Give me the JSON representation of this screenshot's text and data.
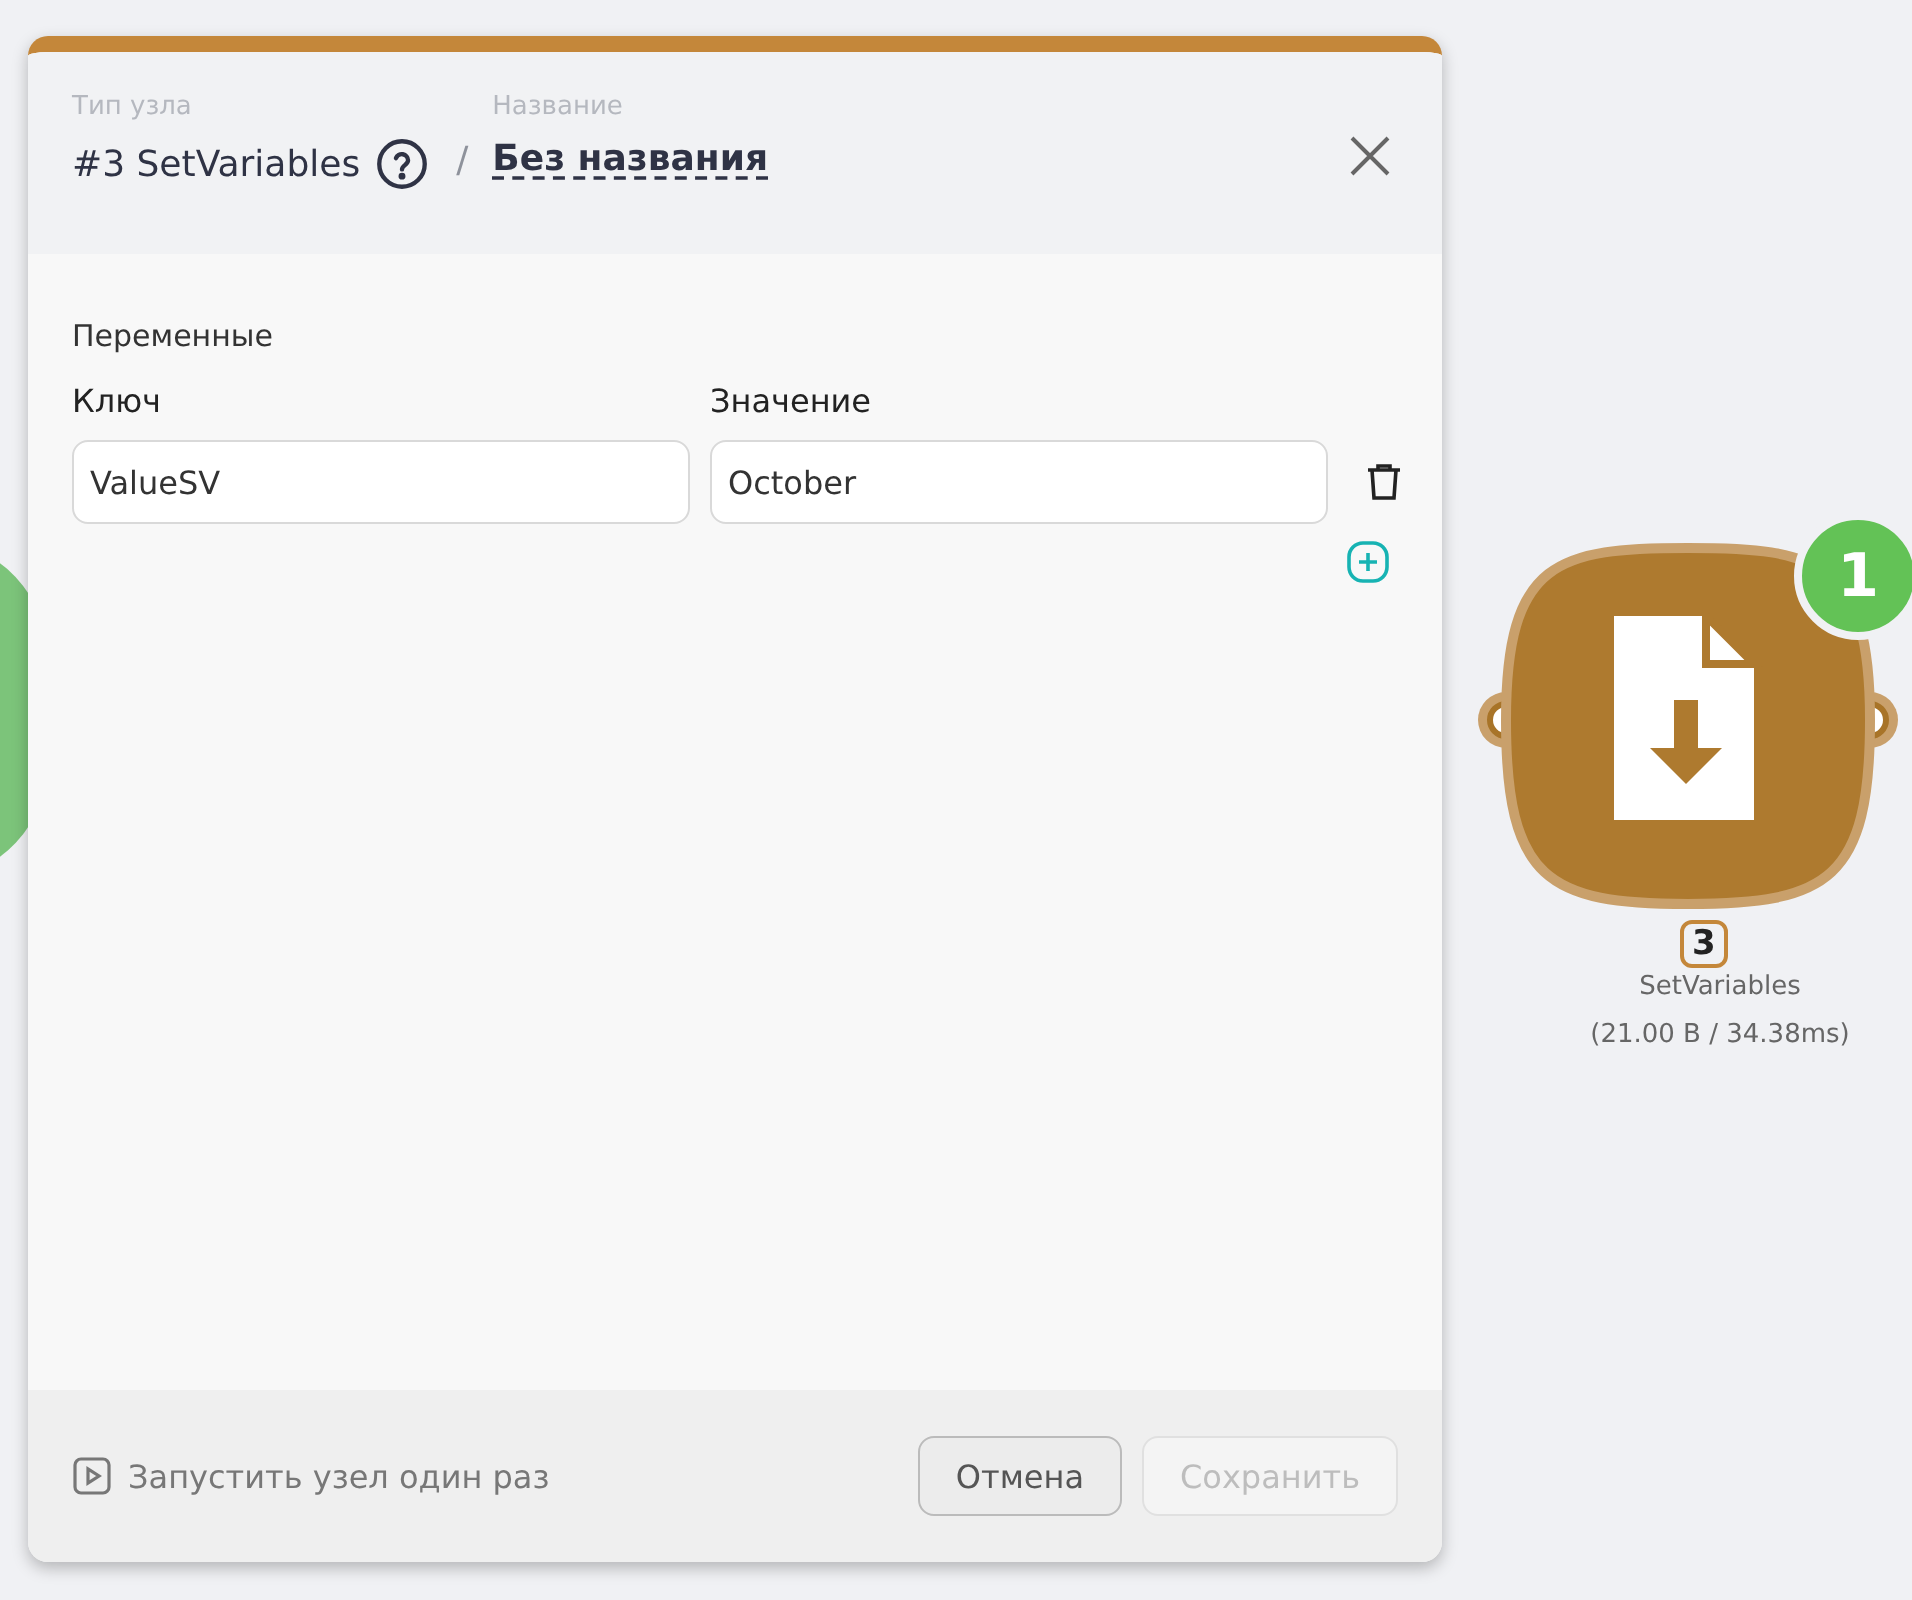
{
  "node_editor": {
    "node_type_label": "Тип узла",
    "node_type": "#3 SetVariables",
    "separator": "/",
    "name_label": "Название",
    "name": "Без названия",
    "section_title": "Переменные",
    "columns": [
      "Ключ",
      "Значение"
    ],
    "variables": [
      {
        "key": "ValueSV",
        "value": "October"
      }
    ],
    "run_once": "Запустить узел один раз",
    "buttons": [
      {
        "label": "Отмена",
        "disabled": false
      },
      {
        "label": "Сохранить",
        "disabled": true
      }
    ]
  },
  "canvas_node": {
    "badge": "1",
    "number": "3",
    "title": "SetVariables",
    "stats": "(21.00 B / 34.38ms)"
  }
}
